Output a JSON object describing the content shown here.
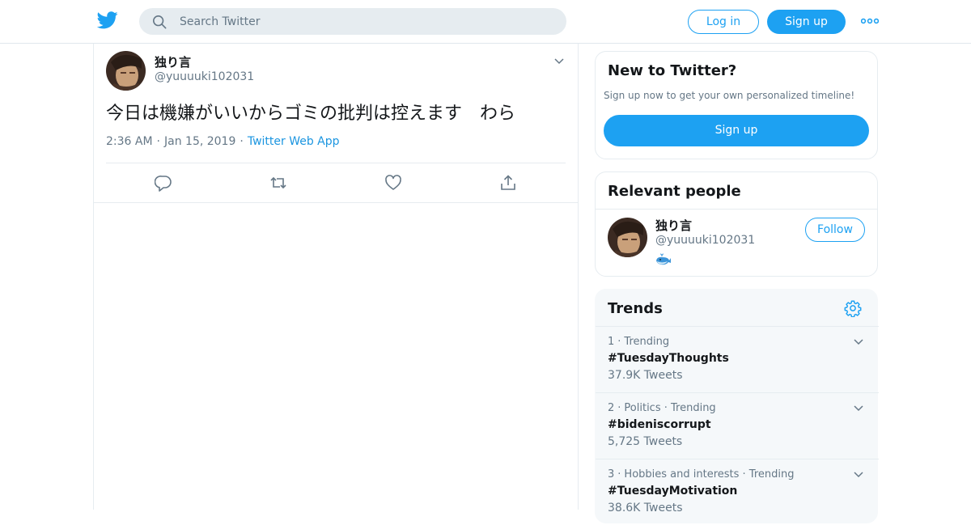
{
  "header": {
    "search_placeholder": "Search Twitter",
    "login_label": "Log in",
    "signup_label": "Sign up"
  },
  "tweet": {
    "author_name": "独り言",
    "author_handle": "@yuuuuki102031",
    "text": "今日は機嫌がいいからゴミの批判は控えます　わら",
    "time": "2:36 AM",
    "date": "Jan 15, 2019",
    "source": "Twitter Web App"
  },
  "new_to_twitter": {
    "title": "New to Twitter?",
    "subtitle": "Sign up now to get your own personalized timeline!",
    "signup_label": "Sign up"
  },
  "relevant_people": {
    "title": "Relevant people",
    "person": {
      "name": "独り言",
      "handle": "@yuuuuki102031",
      "bio_icon": "whale-emoji",
      "follow_label": "Follow"
    }
  },
  "trends": {
    "title": "Trends",
    "items": [
      {
        "rank": "1",
        "category": "Trending",
        "name": "#TuesdayThoughts",
        "count": "37.9K Tweets"
      },
      {
        "rank": "2",
        "category": "Politics · Trending",
        "name": "#bideniscorrupt",
        "count": "5,725 Tweets"
      },
      {
        "rank": "3",
        "category": "Hobbies and interests · Trending",
        "name": "#TuesdayMotivation",
        "count": "38.6K Tweets"
      }
    ]
  },
  "colors": {
    "accent": "#1da1f2",
    "link": "#1b95e0",
    "secondary_text": "#657786",
    "border": "#e6ecf0",
    "trends_bg": "#f5f8fa"
  }
}
